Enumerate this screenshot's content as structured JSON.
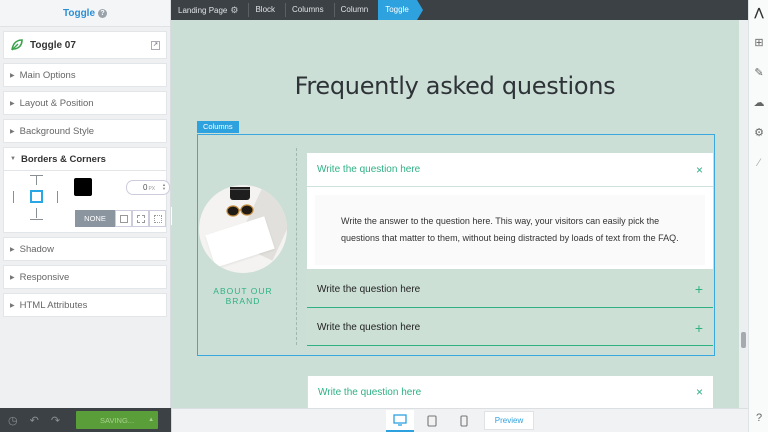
{
  "panel": {
    "header": "Toggle",
    "help_glyph": "?",
    "element_name": "Toggle 07",
    "sections": [
      "Main Options",
      "Layout & Position",
      "Background Style",
      "Borders & Corners",
      "Shadow",
      "Responsive",
      "HTML Attributes"
    ],
    "border": {
      "width_value": "0",
      "width_unit": "PX",
      "style_none": "NONE",
      "color": "#000000"
    }
  },
  "bottom_left": {
    "saving_label": "SAVING..."
  },
  "breadcrumb": [
    "Landing Page",
    "Block",
    "Columns",
    "Column",
    "Toggle"
  ],
  "canvas": {
    "title": "Frequently asked questions",
    "columns_tag": "Columns",
    "brand_text": "ABOUT OUR BRAND",
    "faqs": [
      {
        "question": "Write the question here",
        "answer": "Write the answer to the question here. This way, your visitors can easily pick the questions that matter to them, without being distracted by loads of text from the FAQ.",
        "open": true,
        "icon": "×"
      },
      {
        "question": "Write the question here",
        "open": false,
        "icon": "+"
      },
      {
        "question": "Write the question here",
        "open": false,
        "icon": "+"
      }
    ],
    "bottom_faq": {
      "question": "Write the question here",
      "icon": "×"
    }
  },
  "devicebar": {
    "preview_label": "Preview"
  },
  "colors": {
    "accent": "#2ea1df",
    "brand_green": "#2fb184",
    "canvas_bg": "#ccdfd6",
    "dark_bar": "#3c4146"
  }
}
